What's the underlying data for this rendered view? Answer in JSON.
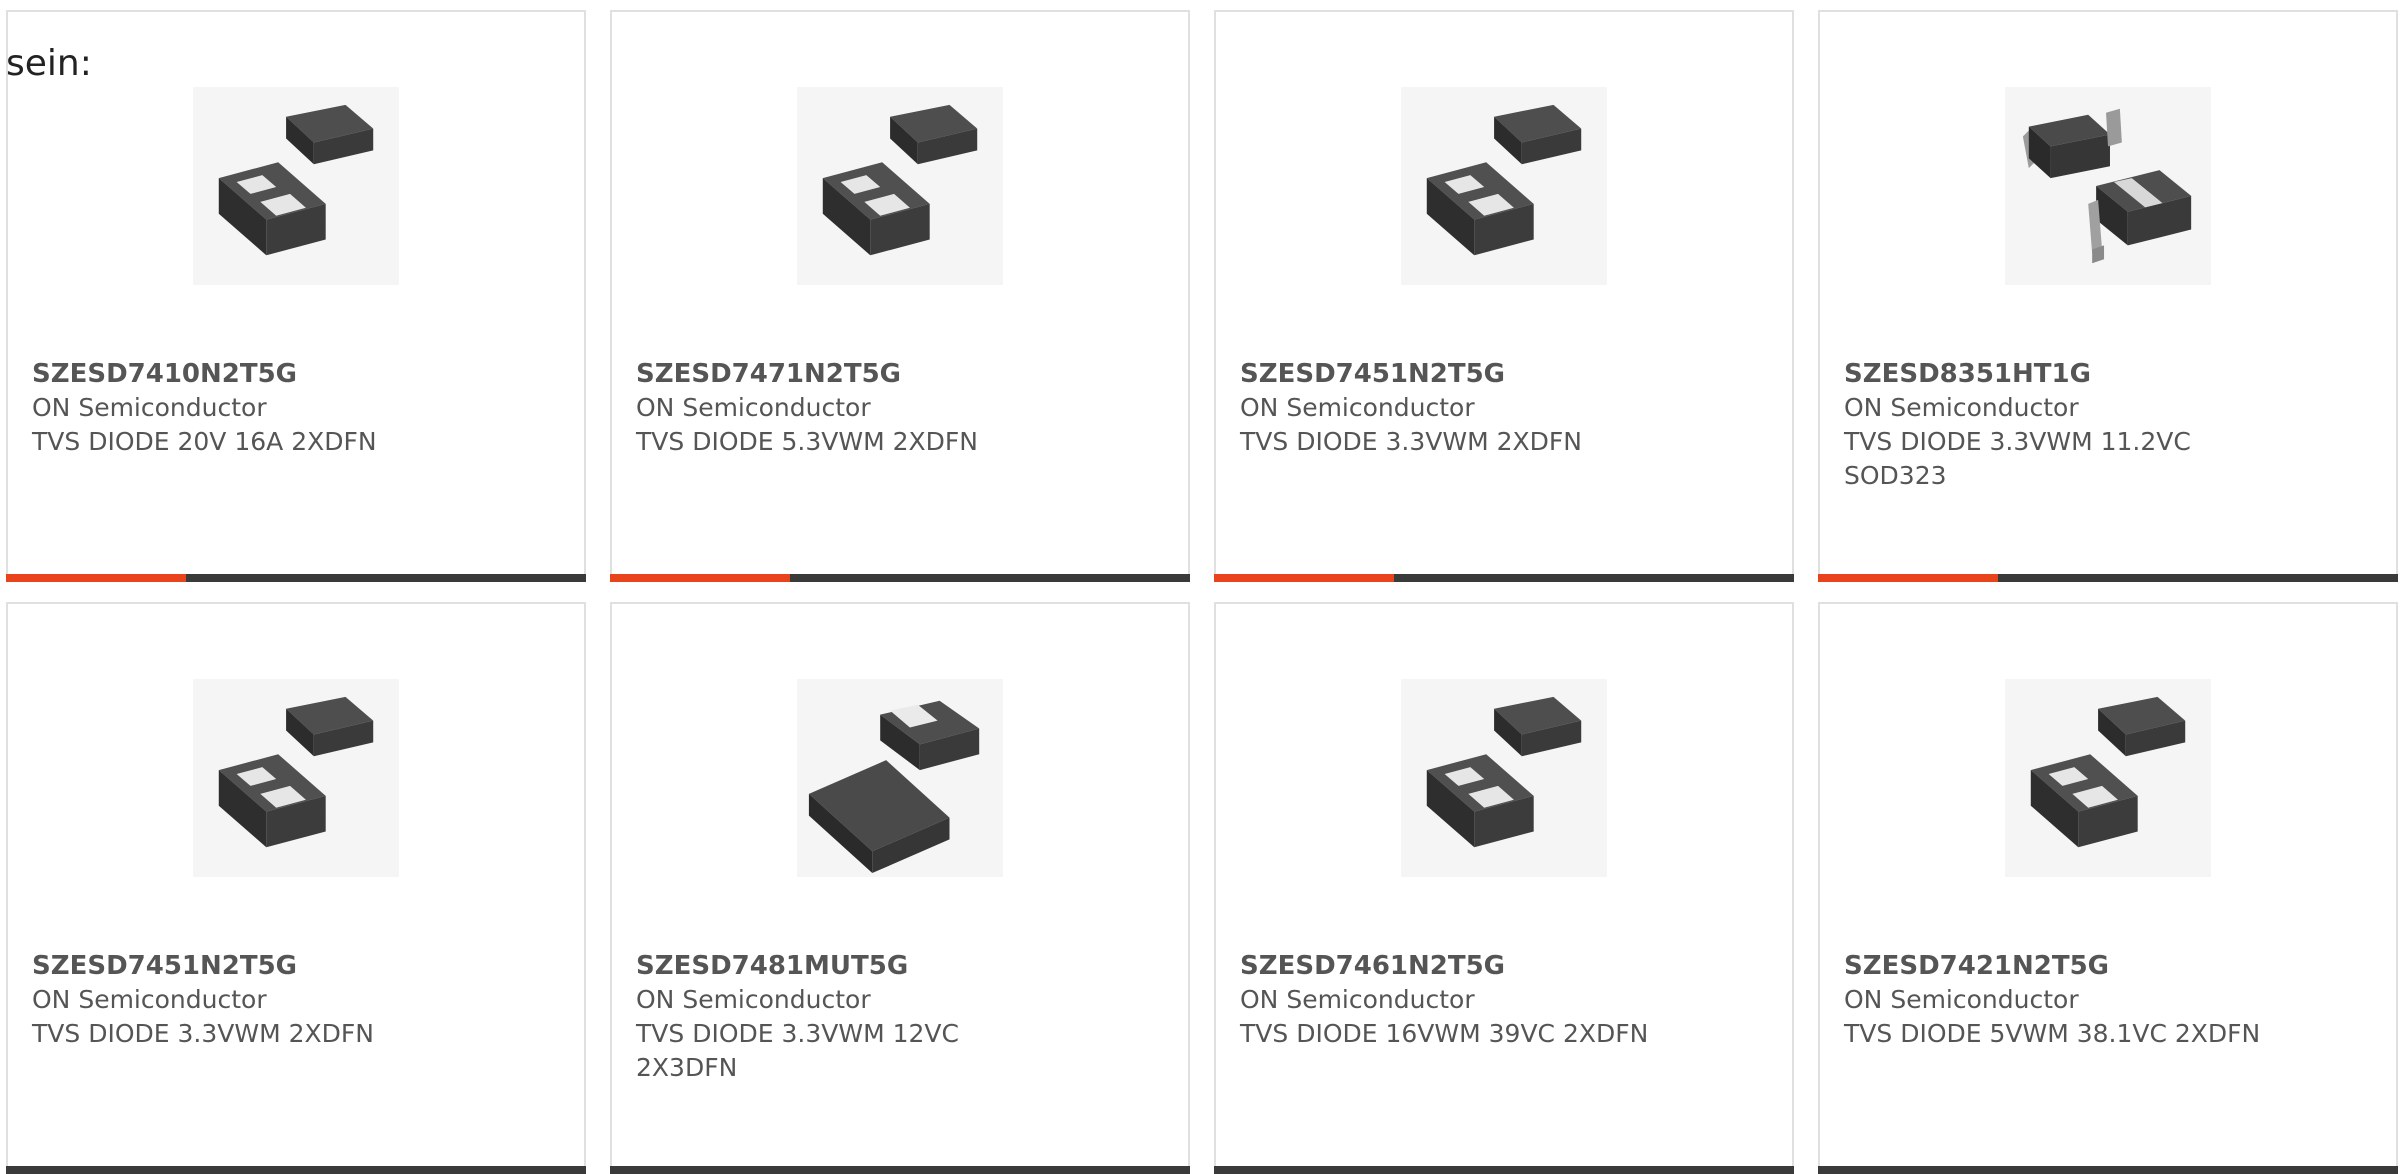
{
  "intro_text": "sein:",
  "colors": {
    "accent": "#e8431b",
    "bar": "#3a3a3a",
    "card_border": "#e0e0e0",
    "text": "#555555"
  },
  "products": [
    {
      "part_number": "SZESD7410N2T5G",
      "manufacturer": "ON Semiconductor",
      "description": "TVS DIODE 20V 16A 2XDFN",
      "image_icon": "dfn-two-chip-icon",
      "accent_fraction": 0.31
    },
    {
      "part_number": "SZESD7471N2T5G",
      "manufacturer": "ON Semiconductor",
      "description": "TVS DIODE 5.3VWM 2XDFN",
      "image_icon": "dfn-two-chip-icon",
      "accent_fraction": 0.31
    },
    {
      "part_number": "SZESD7451N2T5G",
      "manufacturer": "ON Semiconductor",
      "description": "TVS DIODE 3.3VWM 2XDFN",
      "image_icon": "dfn-two-chip-icon",
      "accent_fraction": 0.31
    },
    {
      "part_number": "SZESD8351HT1G",
      "manufacturer": "ON Semiconductor",
      "description": "TVS DIODE 3.3VWM 11.2VC SOD323",
      "image_icon": "sod323-chip-icon",
      "accent_fraction": 0.31
    },
    {
      "part_number": "SZESD7451N2T5G",
      "manufacturer": "ON Semiconductor",
      "description": "TVS DIODE 3.3VWM 2XDFN",
      "image_icon": "dfn-two-chip-icon",
      "accent_fraction": 0
    },
    {
      "part_number": "SZESD7481MUT5G",
      "manufacturer": "ON Semiconductor",
      "description": "TVS DIODE 3.3VWM 12VC 2X3DFN",
      "image_icon": "dfn-large-chip-icon",
      "accent_fraction": 0
    },
    {
      "part_number": "SZESD7461N2T5G",
      "manufacturer": "ON Semiconductor",
      "description": "TVS DIODE 16VWM 39VC 2XDFN",
      "image_icon": "dfn-two-chip-icon",
      "accent_fraction": 0
    },
    {
      "part_number": "SZESD7421N2T5G",
      "manufacturer": "ON Semiconductor",
      "description": "TVS DIODE 5VWM 38.1VC 2XDFN",
      "image_icon": "dfn-two-chip-icon",
      "accent_fraction": 0
    }
  ]
}
